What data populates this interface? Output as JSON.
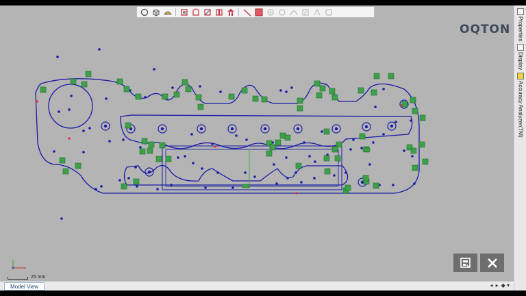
{
  "app": {
    "logo_text": "OQTON"
  },
  "toolbar": {
    "buttons": [
      {
        "name": "circle-tool-icon",
        "enabled": true
      },
      {
        "name": "cube-view-icon",
        "enabled": true
      },
      {
        "name": "surface-tool-icon",
        "enabled": true
      },
      {
        "name": "box-select-icon",
        "enabled": true
      },
      {
        "name": "face-tool-icon",
        "enabled": true
      },
      {
        "name": "section-tool-icon",
        "enabled": true
      },
      {
        "name": "split-view-icon",
        "enabled": true
      },
      {
        "name": "support-tool-icon",
        "enabled": true
      },
      {
        "name": "line-tool-icon",
        "enabled": true
      },
      {
        "name": "red-select-icon",
        "enabled": true
      },
      {
        "name": "point-tool-icon",
        "enabled": false
      },
      {
        "name": "node-tool-icon",
        "enabled": false
      },
      {
        "name": "curve-tool-icon",
        "enabled": false
      },
      {
        "name": "edit-tool-icon",
        "enabled": false
      },
      {
        "name": "transform-tool-icon",
        "enabled": false
      },
      {
        "name": "measure-tool-icon",
        "enabled": false
      }
    ],
    "accent_color": "#d03040"
  },
  "side_panel": {
    "tabs": [
      {
        "label": "Properties"
      },
      {
        "label": "Display"
      },
      {
        "label": "Accuracy Analyzer(TM)"
      }
    ]
  },
  "viewport": {
    "background_color": "#b4b4b4",
    "geometry_color": "#1a1aa8",
    "marker_color": "#3ea04a",
    "scale_label": "25 mm"
  },
  "actions": {
    "confirm": {
      "icon": "apply-icon"
    },
    "cancel": {
      "icon": "close-icon"
    }
  },
  "status": {
    "tab_label": "Model View",
    "nav_left": "◂",
    "nav_right": "▸",
    "nav_menu": "◆ ▾"
  }
}
